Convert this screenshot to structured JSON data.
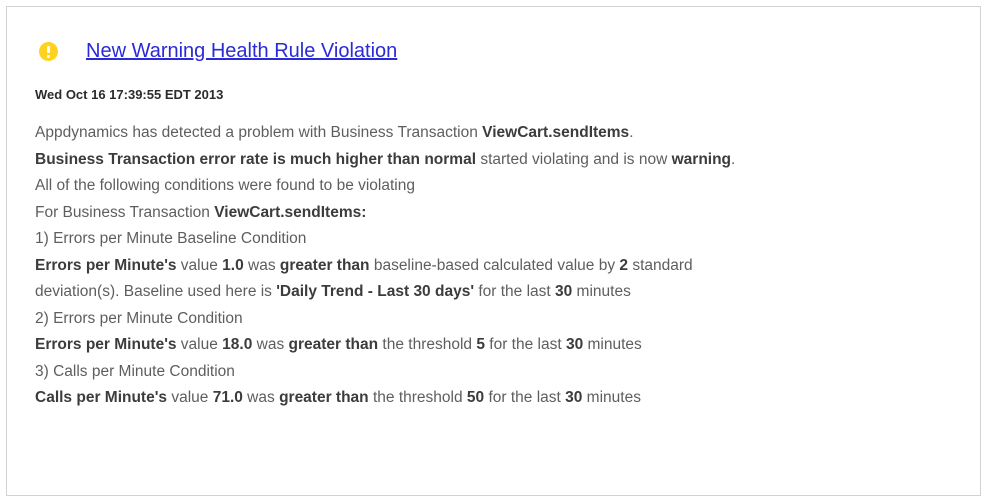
{
  "alert": {
    "title": "New Warning Health Rule Violation",
    "timestamp": "Wed Oct 16 17:39:55 EDT 2013",
    "lines": [
      [
        {
          "t": "Appdynamics has detected a problem with Business Transaction "
        },
        {
          "t": "ViewCart.sendItems",
          "b": true
        },
        {
          "t": "."
        }
      ],
      [
        {
          "t": "Business Transaction error rate is much higher than normal",
          "b": true
        },
        {
          "t": " started violating and is now "
        },
        {
          "t": "warning",
          "b": true
        },
        {
          "t": "."
        }
      ],
      [
        {
          "t": "All of the following conditions were found to be violating"
        }
      ],
      [
        {
          "t": "For Business Transaction "
        },
        {
          "t": "ViewCart.sendItems:",
          "b": true
        }
      ],
      [
        {
          "t": "1) Errors per Minute Baseline Condition"
        }
      ],
      [
        {
          "t": "Errors per Minute's",
          "b": true
        },
        {
          "t": " value "
        },
        {
          "t": "1.0",
          "b": true
        },
        {
          "t": " was "
        },
        {
          "t": "greater than",
          "b": true
        },
        {
          "t": " baseline-based calculated value by "
        },
        {
          "t": "2",
          "b": true
        },
        {
          "t": " standard"
        }
      ],
      [
        {
          "t": "deviation(s). Baseline used here is "
        },
        {
          "t": "'Daily Trend - Last 30 days'",
          "b": true
        },
        {
          "t": " for the last "
        },
        {
          "t": "30",
          "b": true
        },
        {
          "t": " minutes"
        }
      ],
      [
        {
          "t": "2) Errors per Minute Condition"
        }
      ],
      [
        {
          "t": "Errors per Minute's",
          "b": true
        },
        {
          "t": " value "
        },
        {
          "t": "18.0",
          "b": true
        },
        {
          "t": " was "
        },
        {
          "t": "greater than",
          "b": true
        },
        {
          "t": " the threshold "
        },
        {
          "t": "5",
          "b": true
        },
        {
          "t": " for the last "
        },
        {
          "t": "30",
          "b": true
        },
        {
          "t": " minutes"
        }
      ],
      [
        {
          "t": "3) Calls per Minute Condition"
        }
      ],
      [
        {
          "t": "Calls per Minute's",
          "b": true
        },
        {
          "t": " value "
        },
        {
          "t": "71.0",
          "b": true
        },
        {
          "t": " was "
        },
        {
          "t": "greater than",
          "b": true
        },
        {
          "t": " the threshold "
        },
        {
          "t": "50",
          "b": true
        },
        {
          "t": " for the last "
        },
        {
          "t": "30",
          "b": true
        },
        {
          "t": " minutes"
        }
      ]
    ]
  },
  "icons": {
    "status": "warning-icon"
  },
  "colors": {
    "warning": "#ffd21f",
    "link": "#2a2ad6"
  }
}
